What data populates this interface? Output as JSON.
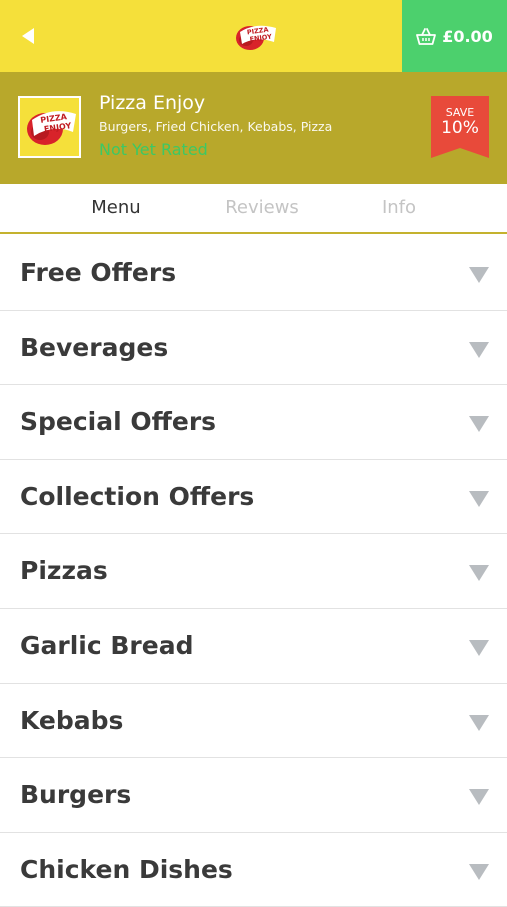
{
  "topbar": {
    "back_icon": "back-arrow-icon",
    "logo_text_line1": "PIZZA",
    "logo_text_line2": "ENJOY",
    "basket_icon": "basket-icon",
    "basket_total": "£0.00",
    "colors": {
      "bar": "#f5e03a",
      "basket": "#4cd06d"
    }
  },
  "restaurant": {
    "name": "Pizza Enjoy",
    "cuisines": "Burgers, Fried Chicken, Kebabs, Pizza",
    "rating": "Not Yet Rated",
    "logo_text_line1": "PIZZA",
    "logo_text_line2": "ENJOY",
    "badge": {
      "label": "SAVE",
      "value": "10%"
    },
    "colors": {
      "header": "#b8a82b",
      "rating": "#3cc864",
      "badge": "#e84a3a"
    }
  },
  "tabs": [
    {
      "label": "Menu",
      "active": true
    },
    {
      "label": "Reviews",
      "active": false
    },
    {
      "label": "Info",
      "active": false
    }
  ],
  "categories": [
    {
      "label": "Free Offers"
    },
    {
      "label": "Beverages"
    },
    {
      "label": "Special Offers"
    },
    {
      "label": "Collection Offers"
    },
    {
      "label": "Pizzas"
    },
    {
      "label": "Garlic Bread"
    },
    {
      "label": "Kebabs"
    },
    {
      "label": "Burgers"
    },
    {
      "label": "Chicken Dishes"
    }
  ]
}
